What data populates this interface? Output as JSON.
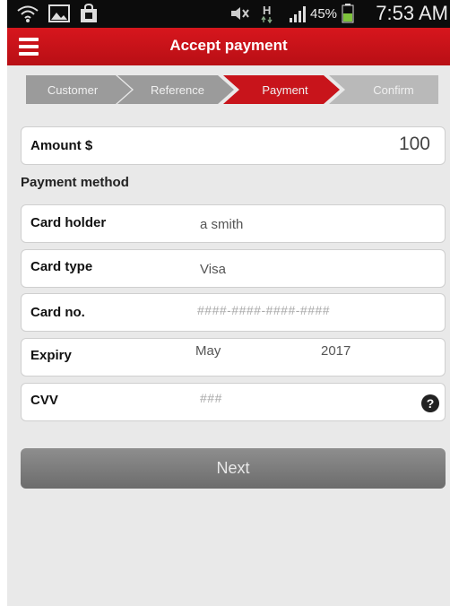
{
  "status_bar": {
    "battery_percent": "45%",
    "time": "7:53 AM",
    "icons": [
      "wifi-icon",
      "image-icon",
      "bag-icon",
      "mute-icon",
      "network-h-icon",
      "signal-icon",
      "battery-icon"
    ]
  },
  "header": {
    "title": "Accept payment",
    "menu_icon": "hamburger-icon"
  },
  "steps": [
    {
      "label": "Customer",
      "state": "done"
    },
    {
      "label": "Reference",
      "state": "done"
    },
    {
      "label": "Payment",
      "state": "active"
    },
    {
      "label": "Confirm",
      "state": "pending"
    }
  ],
  "form": {
    "amount": {
      "label": "Amount $",
      "value": "100"
    },
    "payment_method_heading": "Payment method",
    "card_holder": {
      "label": "Card holder",
      "value": "a smith"
    },
    "card_type": {
      "label": "Card type",
      "value": "Visa"
    },
    "card_no": {
      "label": "Card no.",
      "placeholder": "####-####-####-####"
    },
    "expiry": {
      "label": "Expiry",
      "month": "May",
      "year": "2017"
    },
    "cvv": {
      "label": "CVV",
      "placeholder": "###",
      "help_icon": "question-mark-icon",
      "help_text": "?"
    }
  },
  "next_button": {
    "label": "Next"
  },
  "colors": {
    "brand_red": "#c8141b",
    "step_done": "#9a9a9a",
    "step_active": "#c8141b",
    "background": "#e9e9e9",
    "button_gray": "#7d7d7d"
  }
}
